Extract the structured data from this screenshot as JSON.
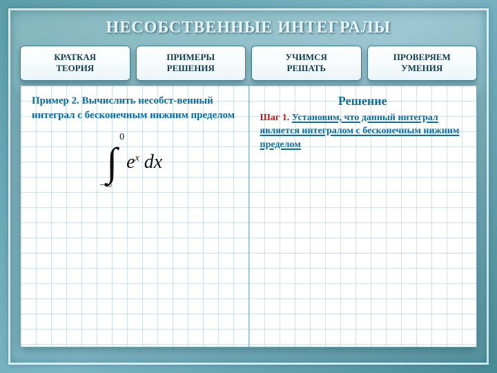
{
  "title": "НЕСОБСТВЕННЫЕ ИНТЕГРАЛЫ",
  "tabs": {
    "theory": "КРАТКАЯ\nТЕОРИЯ",
    "examples": "ПРИМЕРЫ\nРЕШЕНИЯ",
    "practice": "УЧИМСЯ\nРЕШАТЬ",
    "check": "ПРОВЕРЯЕМ\nУМЕНИЯ"
  },
  "left": {
    "example_label": "Пример 2.",
    "problem_text": "Вычислить несобст-венный интеграл с бесконечным нижним пределом",
    "integral": {
      "upper": "0",
      "lower": "−∞",
      "expr_base": "e",
      "expr_sup": "x",
      "dx": " dx"
    }
  },
  "right": {
    "solution_title": "Решение",
    "step_label": "Шаг 1.",
    "step_text": "Установим, что данный интеграл является интегралом с бесконечным нижним пределом"
  }
}
